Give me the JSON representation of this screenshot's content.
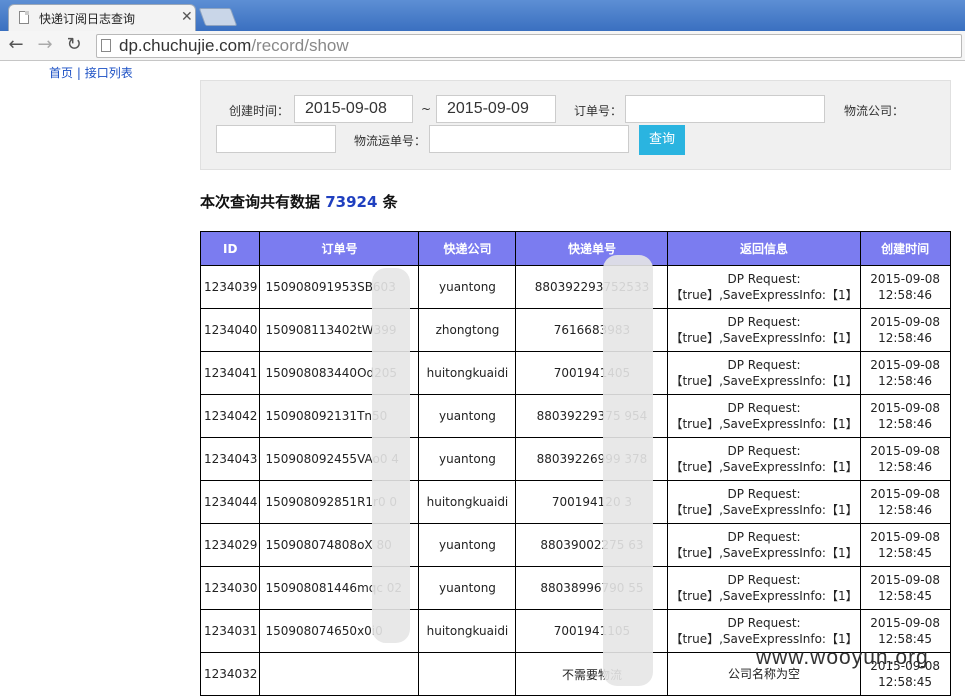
{
  "browser": {
    "tab_title": "快递订阅日志查询",
    "url_host": "dp.chuchujie.com",
    "url_path": "/record/show"
  },
  "toplinks": {
    "home": "首页",
    "sep": "|",
    "api_list": "接口列表"
  },
  "search": {
    "created_label": "创建时间：",
    "date_from": "2015-09-08",
    "tilde": "~",
    "date_to": "2015-09-09",
    "order_label": "订单号：",
    "order_value": "",
    "company_label": "物流公司：",
    "company_value": "",
    "tracking_label": "物流运单号：",
    "tracking_value": "",
    "submit_label": "查询"
  },
  "summary": {
    "prefix": "本次查询共有数据",
    "count": "73924",
    "suffix": "条"
  },
  "table": {
    "columns": [
      "ID",
      "订单号",
      "快递公司",
      "快递单号",
      "返回信息",
      "创建时间"
    ],
    "rows": [
      {
        "id": "1234039",
        "order": "150908091953SB603",
        "company": "yuantong",
        "tracking": "880392293752533",
        "info1": "DP Request:",
        "info2": "【true】,SaveExpressInfo:【1】",
        "date": "2015-09-08",
        "time": "12:58:46"
      },
      {
        "id": "1234040",
        "order": "150908113402tW399",
        "company": "zhongtong",
        "tracking": "7616683983",
        "info1": "DP Request:",
        "info2": "【true】,SaveExpressInfo:【1】",
        "date": "2015-09-08",
        "time": "12:58:46"
      },
      {
        "id": "1234041",
        "order": "150908083440Od205",
        "company": "huitongkuaidi",
        "tracking": "7001941405",
        "info1": "DP Request:",
        "info2": "【true】,SaveExpressInfo:【1】",
        "date": "2015-09-08",
        "time": "12:58:46"
      },
      {
        "id": "1234042",
        "order": "150908092131Tn50",
        "company": "yuantong",
        "tracking": "88039229375     954",
        "info1": "DP Request:",
        "info2": "【true】,SaveExpressInfo:【1】",
        "date": "2015-09-08",
        "time": "12:58:46"
      },
      {
        "id": "1234043",
        "order": "150908092455VAo0    4",
        "company": "yuantong",
        "tracking": "88039226999     378",
        "info1": "DP Request:",
        "info2": "【true】,SaveExpressInfo:【1】",
        "date": "2015-09-08",
        "time": "12:58:46"
      },
      {
        "id": "1234044",
        "order": "150908092851R1r0    0",
        "company": "huitongkuaidi",
        "tracking": "700194120     3",
        "info1": "DP Request:",
        "info2": "【true】,SaveExpressInfo:【1】",
        "date": "2015-09-08",
        "time": "12:58:46"
      },
      {
        "id": "1234029",
        "order": "150908074808oX    80",
        "company": "yuantong",
        "tracking": "88039002275     63",
        "info1": "DP Request:",
        "info2": "【true】,SaveExpressInfo:【1】",
        "date": "2015-09-08",
        "time": "12:58:45"
      },
      {
        "id": "1234030",
        "order": "150908081446mqc    02",
        "company": "yuantong",
        "tracking": "88038996790     55",
        "info1": "DP Request:",
        "info2": "【true】,SaveExpressInfo:【1】",
        "date": "2015-09-08",
        "time": "12:58:45"
      },
      {
        "id": "1234031",
        "order": "150908074650x0i0",
        "company": "huitongkuaidi",
        "tracking": "7001941105",
        "info1": "DP Request:",
        "info2": "【true】,SaveExpressInfo:【1】",
        "date": "2015-09-08",
        "time": "12:58:45"
      },
      {
        "id": "1234032",
        "order": "",
        "company": "",
        "tracking": "不需要物流",
        "info1": "公司名称为空",
        "info2": "",
        "date": "2015-09-08",
        "time": "12:58:45"
      }
    ]
  },
  "watermark": "www.wooyun.org",
  "colors": {
    "header_bg": "#7b7cf0",
    "button_bg": "#2ab4e0",
    "count": "#1f3fbf",
    "link": "#1a4fc4"
  }
}
